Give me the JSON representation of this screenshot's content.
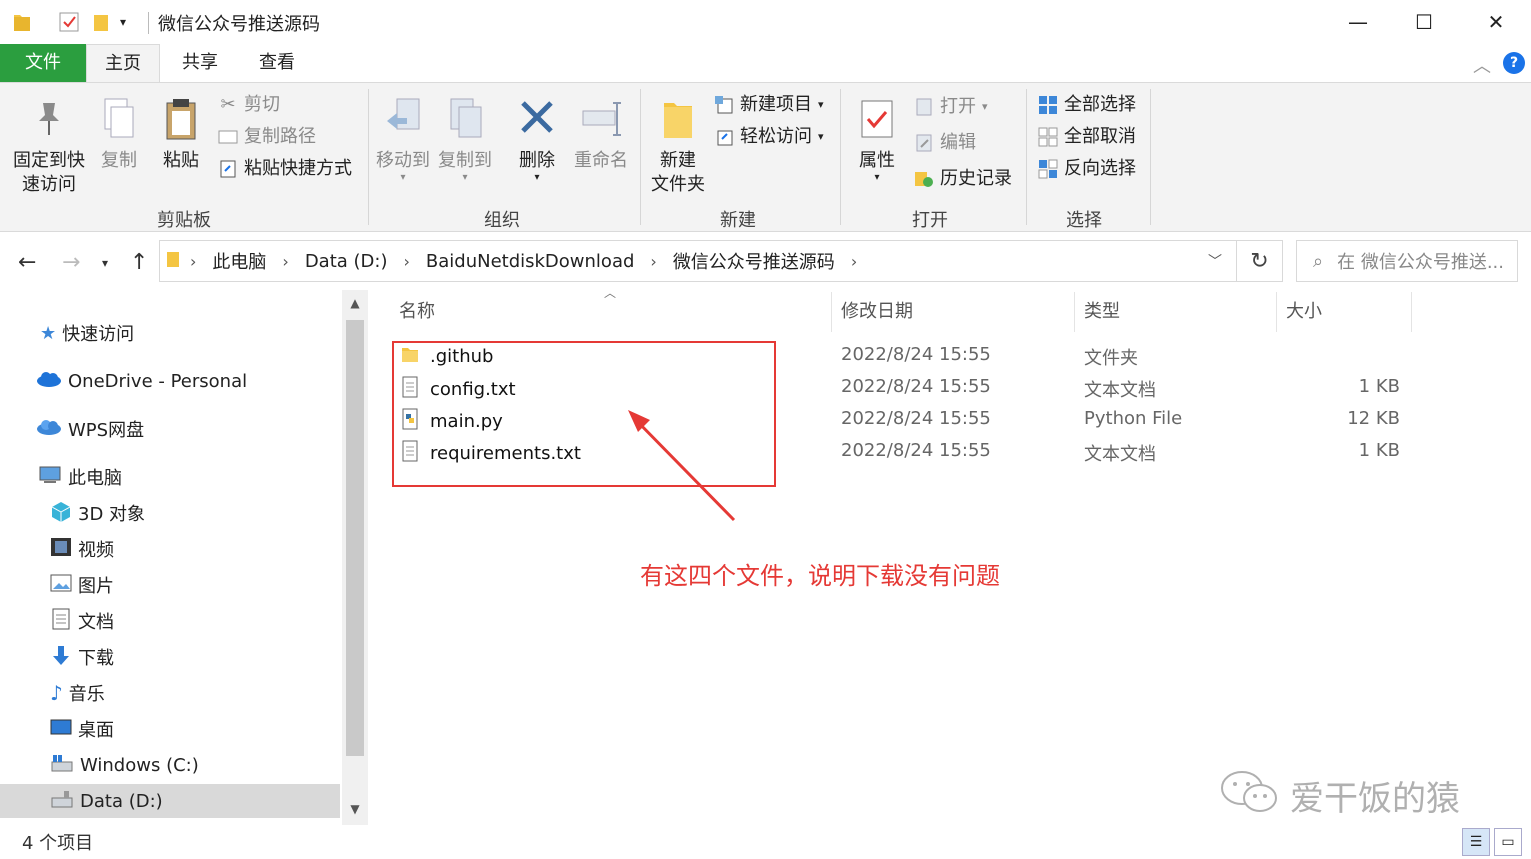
{
  "window": {
    "title": "微信公众号推送源码",
    "minimize": "—",
    "maximize": "☐",
    "close": "✕"
  },
  "tabs": [
    {
      "label": "文件"
    },
    {
      "label": "主页"
    },
    {
      "label": "共享"
    },
    {
      "label": "查看"
    }
  ],
  "help_label": "?",
  "ribbon": {
    "clipboard": {
      "group_label": "剪贴板",
      "pin_quick_access": "固定到快\n速访问",
      "pin_line1": "固定到快",
      "pin_line2": "速访问",
      "copy": "复制",
      "paste": "粘贴",
      "cut": "剪切",
      "copy_path": "复制路径",
      "paste_shortcut": "粘贴快捷方式"
    },
    "organize": {
      "group_label": "组织",
      "move_to": "移动到",
      "copy_to": "复制到",
      "delete": "删除",
      "rename": "重命名"
    },
    "new": {
      "group_label": "新建",
      "new_folder_line1": "新建",
      "new_folder_line2": "文件夹",
      "new_item": "新建项目",
      "easy_access": "轻松访问"
    },
    "open": {
      "group_label": "打开",
      "properties": "属性",
      "open": "打开",
      "edit": "编辑",
      "history": "历史记录"
    },
    "select": {
      "group_label": "选择",
      "select_all": "全部选择",
      "select_none": "全部取消",
      "invert": "反向选择"
    }
  },
  "address": {
    "crumbs": [
      "此电脑",
      "Data (D:)",
      "BaiduNetdiskDownload",
      "微信公众号推送源码"
    ],
    "search_placeholder": "在 微信公众号推送..."
  },
  "nav": {
    "quick_access": "快速访问",
    "onedrive": "OneDrive - Personal",
    "wps": "WPS网盘",
    "this_pc": "此电脑",
    "items": [
      "3D 对象",
      "视频",
      "图片",
      "文档",
      "下载",
      "音乐",
      "桌面",
      "Windows (C:)",
      "Data (D:)"
    ]
  },
  "columns": {
    "name": "名称",
    "modified": "修改日期",
    "type": "类型",
    "size": "大小"
  },
  "files": [
    {
      "name": ".github",
      "modified": "2022/8/24 15:55",
      "type": "文件夹",
      "size": "",
      "icon": "folder-icon"
    },
    {
      "name": "config.txt",
      "modified": "2022/8/24 15:55",
      "type": "文本文档",
      "size": "1 KB",
      "icon": "text-file-icon"
    },
    {
      "name": "main.py",
      "modified": "2022/8/24 15:55",
      "type": "Python File",
      "size": "12 KB",
      "icon": "python-file-icon"
    },
    {
      "name": "requirements.txt",
      "modified": "2022/8/24 15:55",
      "type": "文本文档",
      "size": "1 KB",
      "icon": "text-file-icon"
    }
  ],
  "annotation": "有这四个文件，说明下载没有问题",
  "watermark": "爱干饭的猿",
  "status": {
    "item_count": "4 个项目"
  },
  "colors": {
    "file_tab": "#2b9e3f",
    "annotation_red": "#e53935",
    "selected_nav": "#d9d9d9"
  }
}
